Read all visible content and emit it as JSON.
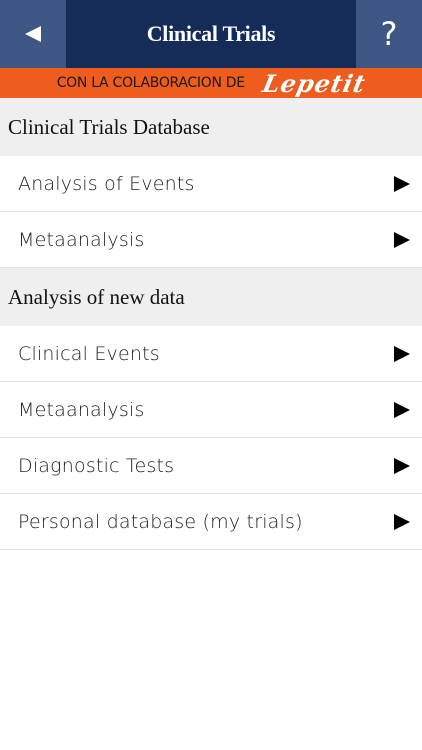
{
  "header": {
    "title": "Clinical Trials",
    "back_icon": "back-triangle-icon",
    "help_label": "?",
    "colors": {
      "bar": "#142c57",
      "buttons": "#3d5683"
    }
  },
  "sponsor": {
    "text": "CON LA COLABORACION DE",
    "logo": "Lepetit",
    "color": "#ee5c1e"
  },
  "sections": [
    {
      "title": "Clinical Trials Database",
      "items": [
        {
          "label": "Analysis of Events"
        },
        {
          "label": "Metaanalysis"
        }
      ]
    },
    {
      "title": "Analysis of new data",
      "items": [
        {
          "label": "Clinical Events"
        },
        {
          "label": "Metaanalysis"
        },
        {
          "label": "Diagnostic Tests"
        },
        {
          "label": "Personal database (my trials)"
        }
      ]
    }
  ],
  "row_icon": "play-triangle-icon"
}
